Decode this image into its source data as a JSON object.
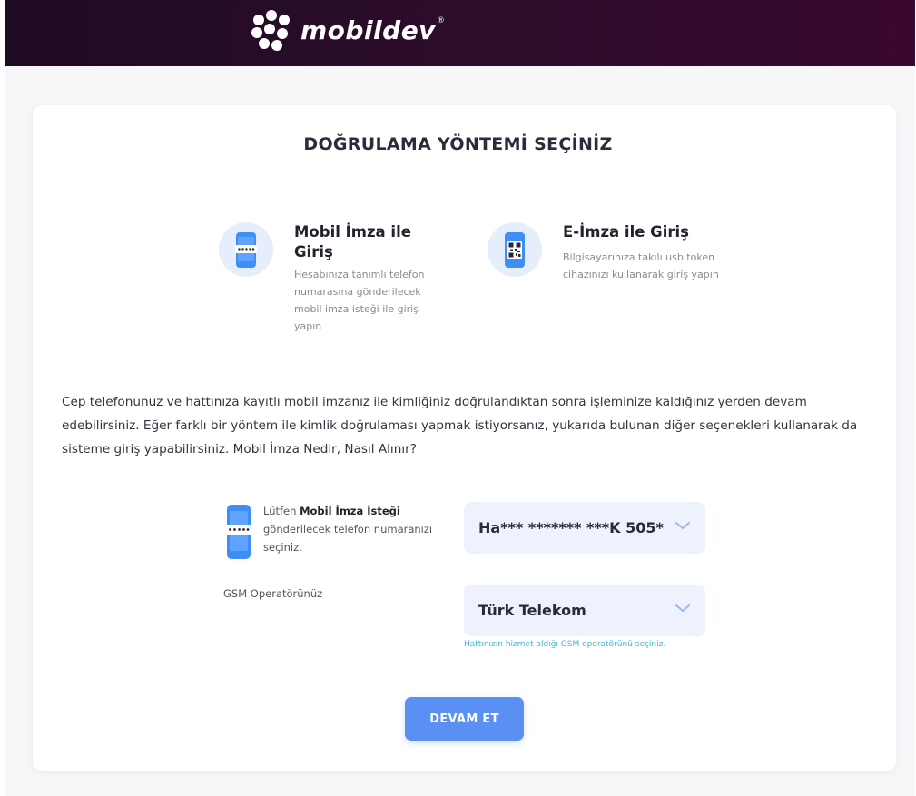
{
  "header": {
    "brand": "mobildev",
    "brand_mark": "®",
    "background_color": "#2a0b2a"
  },
  "card": {
    "title": "DOĞRULAMA YÖNTEMİ SEÇİNİZ"
  },
  "methods": [
    {
      "icon": "mobile-signature-phone-icon",
      "title": "Mobil İmza ile Giriş",
      "description": "Hesabınıza tanımlı telefon numarasına gönderilecek mobil imza isteği ile giriş yapın"
    },
    {
      "icon": "qr-code-phone-icon",
      "title": "E-İmza ile Giriş",
      "description": "Bilgisayarınıza takılı usb token cihazınızı kullanarak giriş yapın"
    }
  ],
  "info_text": "Cep telefonunuz ve hattınıza kayıtlı mobil imzanız ile kimliğiniz doğrulandıktan sonra işleminize kaldığınız yerden devam edebilirsiniz. Eğer farklı bir yöntem ile kimlik doğrulaması yapmak istiyorsanız, yukarıda bulunan diğer seçenekleri kullanarak da sisteme giriş yapabilirsiniz. Mobil İmza Nedir, Nasıl Alınır?",
  "phone_select": {
    "instruction_prefix": "Lütfen ",
    "instruction_bold": "Mobil İmza İsteği",
    "instruction_suffix": " gönderilecek telefon numaranızı seçiniz.",
    "selected_value": "Ha*** ******* ***K 505*"
  },
  "operator_select": {
    "label": "GSM Operatörünüz",
    "selected_value": "Türk Telekom",
    "hint": "Hattınızın hizmet aldığı GSM operatörünü seçiniz."
  },
  "actions": {
    "continue_label": "DEVAM ET"
  },
  "colors": {
    "accent": "#5a8ff4",
    "icon_bg": "#e6edfb",
    "select_bg": "#eef2fc",
    "hint": "#47b3d6"
  }
}
